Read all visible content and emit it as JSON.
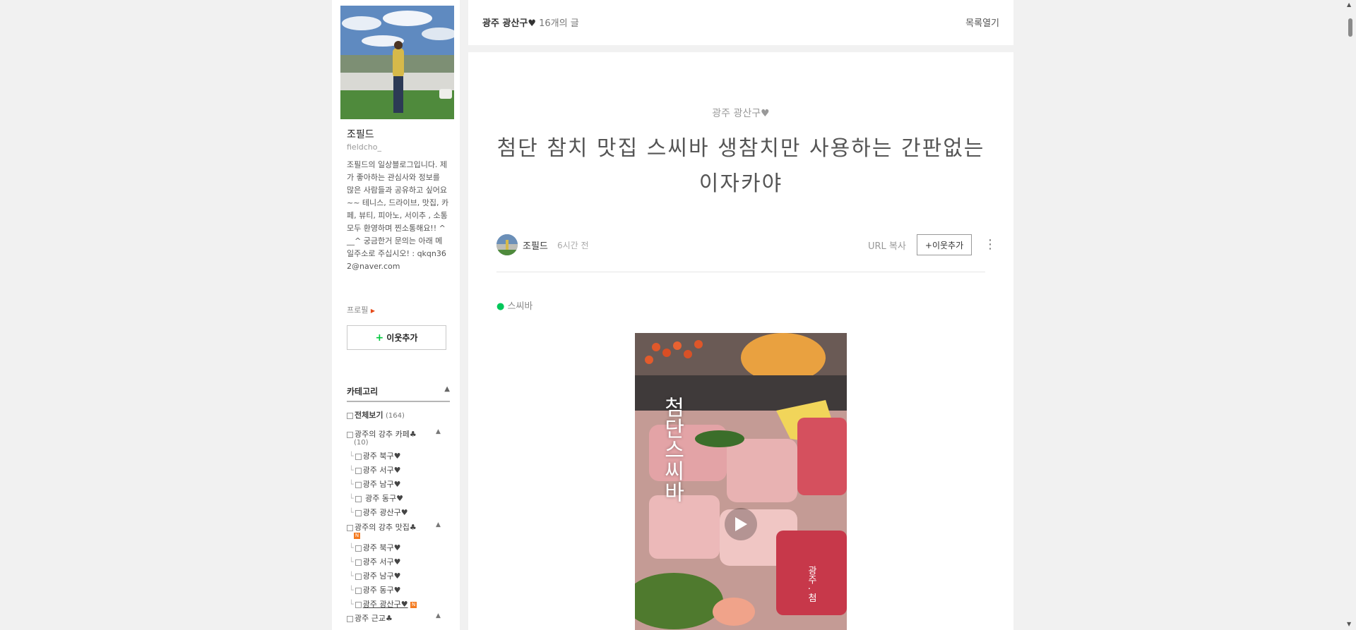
{
  "sidebar": {
    "nickname": "조필드",
    "blog_id": "fieldcho_",
    "intro": "조필드의 일상블로그입니다.    제가 좋아하는 관심사와 정보를 많은 사람들과 공유하고 싶어요~~   테니스, 드라이브, 맛집, 카페, 뷰티, 피아노, 서이추 , 소통 모두 환영하며 찐소통해요!! ^__^ 궁금한거 문의는 아래 메일주소로 주십시오! : qkqn362@naver.com",
    "profile_link": "프로필",
    "add_neighbor": "이웃추가",
    "category_title": "카테고리",
    "categories": {
      "all": {
        "label": "전체보기",
        "count": "(164)"
      },
      "c1": {
        "label": "광주의 강추 카페♣",
        "count": "(10)"
      },
      "c1_1": "광주 북구♥",
      "c1_2": "광주 서구♥",
      "c1_3": "광주 남구♥",
      "c1_4": " 광주 동구♥",
      "c1_5": "광주 광산구♥",
      "c2": {
        "label": "광주의 강추 맛집♣"
      },
      "c2_1": "광주 북구♥",
      "c2_2": "광주 서구♥",
      "c2_3": "광주 남구♥",
      "c2_4": "광주 동구♥",
      "c2_5": "광주 광산구♥",
      "c3": {
        "label": "광주 근교♣"
      },
      "new_badge": "N"
    }
  },
  "topbar": {
    "category": "광주 광산구♥",
    "post_count": "16개의 글",
    "list_open": "목록열기"
  },
  "post": {
    "category": "광주 광산구♥",
    "title": "첨단 참치 맛집 스씨바 생참치만 사용하는 간판없는 이자카야",
    "author": "조필드",
    "time": "6시간 전",
    "url_copy": "URL 복사",
    "neighbor_button": "+이웃추가",
    "place": "스씨바",
    "video_overlay": "첨단스씨바",
    "video_side_text": "광주 . 첨"
  },
  "colors": {
    "accent_green": "#00c73c",
    "new_badge": "#f47b20",
    "page_bg": "#f1f1f1"
  }
}
